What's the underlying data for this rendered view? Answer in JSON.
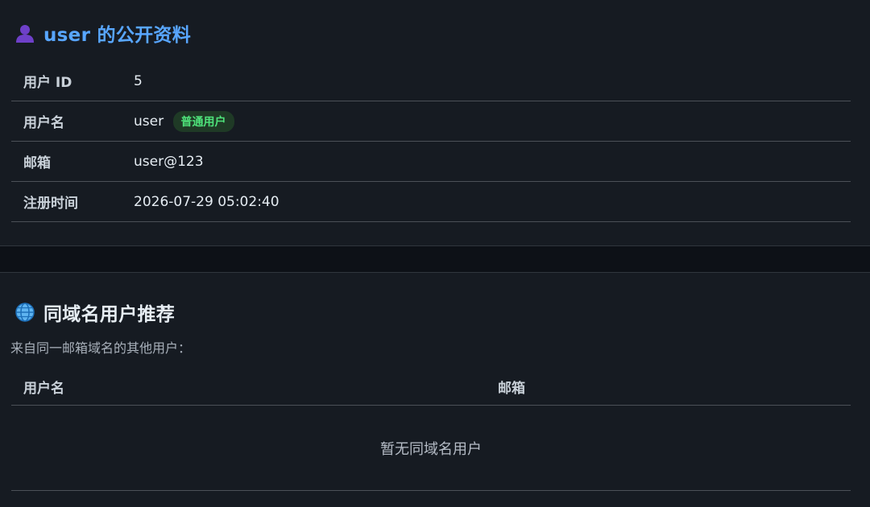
{
  "profile": {
    "title": "user 的公开资料",
    "icon": "user-silhouette-icon",
    "rows": [
      {
        "label": "用户 ID",
        "value": "5"
      },
      {
        "label": "用户名",
        "value": "user",
        "badge": "普通用户"
      },
      {
        "label": "邮箱",
        "value": "user@123"
      },
      {
        "label": "注册时间",
        "value": "2026-07-29 05:02:40"
      }
    ]
  },
  "recommend": {
    "title": "同域名用户推荐",
    "icon": "globe-icon",
    "subtitle": "来自同一邮箱域名的其他用户：",
    "columns": [
      "用户名",
      "邮箱"
    ],
    "empty_text": "暂无同域名用户"
  },
  "colors": {
    "accent": "#58a6ff",
    "badge_bg": "#1f3a26",
    "badge_text": "#4ee27a",
    "background": "#161b22"
  }
}
